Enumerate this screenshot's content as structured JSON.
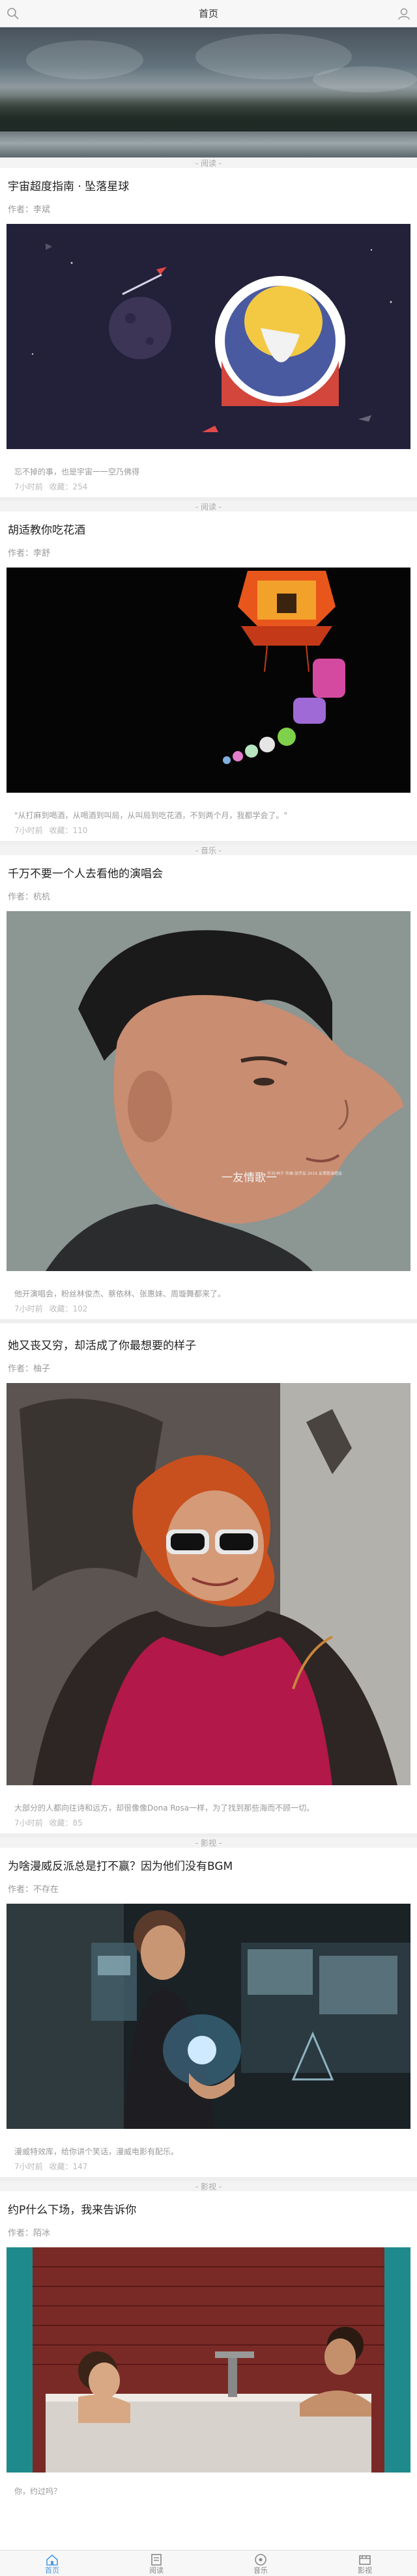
{
  "header": {
    "title": "首页"
  },
  "articles": [
    {
      "tag": "- 阅读 -",
      "title": "宇宙超度指南 · 坠落星球",
      "author": "作者：李斌",
      "excerpt": "忘不掉的事，也是宇宙一一空乃佛得",
      "time": "7小时前",
      "likes": "收藏：254"
    },
    {
      "tag": "- 阅读 -",
      "title": "胡适教你吃花酒",
      "author": "作者：李舒",
      "excerpt": "\"从打麻到喝酒，从喝酒到叫局，从叫局到吃花酒，不到两个月，我都学会了。\"",
      "time": "7小时前",
      "likes": "收藏：110"
    },
    {
      "tag": "- 音乐 -",
      "title": "千万不要一个人去看他的演唱会",
      "author": "作者：杭杭",
      "excerpt": "他开演唱会，粉丝林俊杰、蔡依林、张惠妹、周璇舞都来了。",
      "time": "7小时前",
      "likes": "收藏：102",
      "overlay_title": "一友情歌一",
      "overlay_sub": "作词:林夕 作曲:张学友 2016 友情歌演唱会"
    },
    {
      "tag": "",
      "title": "她又丧又穷，却活成了你最想要的样子",
      "author": "作者：柚子",
      "excerpt": "大部分的人都向往诗和远方，却很像像Dona Rosa一样，为了找到那些海而不顾一切。",
      "time": "7小时前",
      "likes": "收藏：85"
    },
    {
      "tag": "- 影视 -",
      "title": "为啥漫威反派总是打不赢？因为他们没有BGM",
      "author": "作者：不存在",
      "excerpt": "漫威特效库，给你讲个笑话，漫威电影有配乐。",
      "time": "7小时前",
      "likes": "收藏：147"
    },
    {
      "tag": "- 影视 -",
      "title": "约P什么下场，我来告诉你",
      "author": "作者：陌冰",
      "excerpt": "你，约过吗？",
      "time": "",
      "likes": ""
    }
  ],
  "tabbar": [
    {
      "label": "首页",
      "icon": "home-icon",
      "active": true
    },
    {
      "label": "阅读",
      "icon": "book-icon",
      "active": false
    },
    {
      "label": "音乐",
      "icon": "music-icon",
      "active": false
    },
    {
      "label": "影视",
      "icon": "film-icon",
      "active": false
    }
  ],
  "colors": {
    "accent": "#4c9be0",
    "bg": "#eeeeee"
  }
}
